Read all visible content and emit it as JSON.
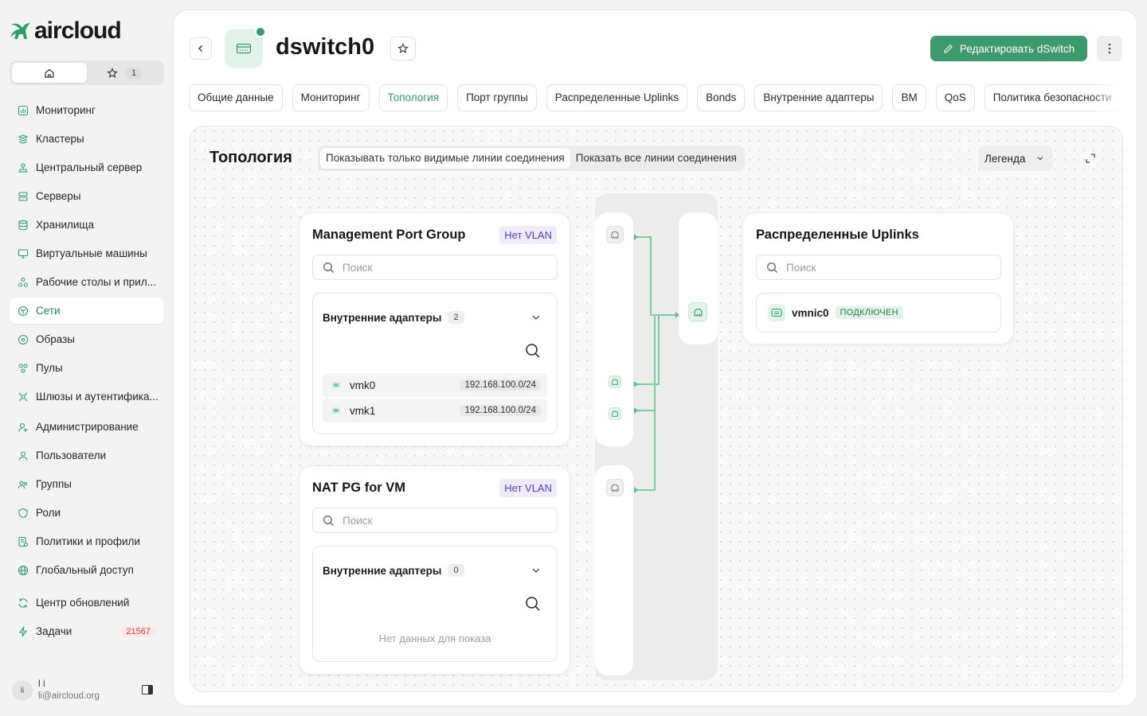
{
  "app": {
    "logo_text": "aircloud"
  },
  "quicktabs": {
    "favorites_count": "1"
  },
  "sidebar": {
    "items": [
      {
        "label": "Мониторинг",
        "icon": "chart-icon"
      },
      {
        "label": "Кластеры",
        "icon": "layers-icon"
      },
      {
        "label": "Центральный сервер",
        "icon": "hub-icon"
      },
      {
        "label": "Серверы",
        "icon": "server-icon"
      },
      {
        "label": "Хранилища",
        "icon": "database-icon"
      },
      {
        "label": "Виртуальные машины",
        "icon": "monitor-icon"
      },
      {
        "label": "Рабочие столы и прил...",
        "icon": "apps-icon"
      },
      {
        "label": "Сети",
        "icon": "network-icon",
        "active": true
      },
      {
        "label": "Образы",
        "icon": "disc-icon"
      },
      {
        "label": "Пулы",
        "icon": "pool-icon"
      },
      {
        "label": "Шлюзы и аутентифика...",
        "icon": "gateway-icon"
      },
      {
        "label": "Администрирование",
        "icon": "admin-icon"
      },
      {
        "label": "Пользователи",
        "icon": "user-icon"
      },
      {
        "label": "Группы",
        "icon": "group-icon"
      },
      {
        "label": "Роли",
        "icon": "shield-icon"
      },
      {
        "label": "Политики и профили",
        "icon": "policy-icon"
      },
      {
        "label": "Глобальный доступ",
        "icon": "globe-icon"
      },
      {
        "label": "Центр обновлений",
        "icon": "refresh-icon"
      },
      {
        "label": "Задачи",
        "icon": "bolt-icon",
        "badge": "21567"
      }
    ]
  },
  "user": {
    "initials": "li",
    "name": "l i",
    "email": "li@aircloud.org"
  },
  "header": {
    "title": "dswitch0",
    "edit_label": "Редактировать dSwitch"
  },
  "tabs": [
    {
      "label": "Общие данные"
    },
    {
      "label": "Мониторинг"
    },
    {
      "label": "Топология",
      "active": true
    },
    {
      "label": "Порт группы"
    },
    {
      "label": "Распределенные Uplinks"
    },
    {
      "label": "Bonds"
    },
    {
      "label": "Внутренние адаптеры"
    },
    {
      "label": "ВМ"
    },
    {
      "label": "QoS"
    },
    {
      "label": "Политика безопасности"
    }
  ],
  "topology": {
    "title": "Топология",
    "toggle": {
      "visible_only": "Показывать только видимые линии соединения",
      "show_all": "Показать все линии соединения",
      "selected": "visible_only"
    },
    "legend_label": "Легенда",
    "colors": {
      "accent": "#2f9e6b",
      "line": "#7dcca2",
      "vlan_bg": "#eeebfb",
      "vlan_text": "#5a3fc0"
    },
    "port_groups": [
      {
        "name": "Management Port Group",
        "vlan": "Нет VLAN",
        "search_placeholder": "Поиск",
        "adapters_label": "Внутренние адаптеры",
        "adapters_count": "2",
        "adapters": [
          {
            "name": "vmk0",
            "ip": "192.168.100.0/24"
          },
          {
            "name": "vmk1",
            "ip": "192.168.100.0/24"
          }
        ]
      },
      {
        "name": "NAT PG for VM",
        "vlan": "Нет VLAN",
        "search_placeholder": "Поиск",
        "adapters_label": "Внутренние адаптеры",
        "adapters_count": "0",
        "empty_text": "Нет данных для показа"
      }
    ],
    "uplinks": {
      "title": "Распределенные Uplinks",
      "search_placeholder": "Поиск",
      "items": [
        {
          "name": "vmnic0",
          "status": "ПОДКЛЮЧЕН"
        }
      ]
    }
  }
}
